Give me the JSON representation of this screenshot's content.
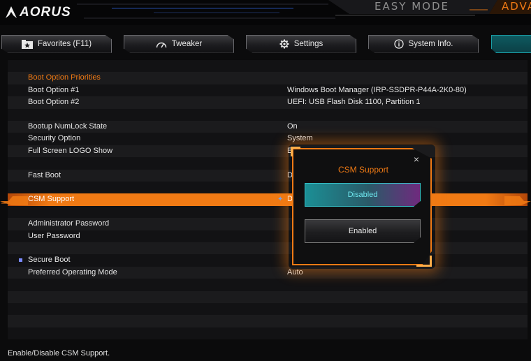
{
  "header": {
    "logo_text": "AORUS",
    "easy_mode_label": "EASY MODE",
    "advanced_mode_label": "ADVA"
  },
  "tabs": [
    {
      "label": "Favorites (F11)",
      "icon": "star-folder-icon"
    },
    {
      "label": "Tweaker",
      "icon": "speedometer-icon"
    },
    {
      "label": "Settings",
      "icon": "gear-icon"
    },
    {
      "label": "System Info.",
      "icon": "info-icon"
    }
  ],
  "settings": {
    "boot_section": "Boot Option Priorities",
    "boot1": {
      "label": "Boot Option #1",
      "value": "Windows Boot Manager (IRP-SSDPR-P44A-2K0-80)"
    },
    "boot2": {
      "label": "Boot Option #2",
      "value": "UEFI: USB Flash Disk 1100, Partition 1"
    },
    "numlock": {
      "label": "Bootup NumLock State",
      "value": "On"
    },
    "security": {
      "label": "Security Option",
      "value": "System"
    },
    "logo": {
      "label": "Full Screen LOGO Show",
      "value": "En"
    },
    "fastboot": {
      "label": "Fast Boot",
      "value": "D"
    },
    "csm": {
      "label": "CSM Support",
      "value": "D"
    },
    "admin_pwd": {
      "label": "Administrator Password"
    },
    "user_pwd": {
      "label": "User Password"
    },
    "secure_boot": {
      "label": "Secure Boot"
    },
    "pref_mode": {
      "label": "Preferred Operating Mode",
      "value": "Auto"
    }
  },
  "popup": {
    "title": "CSM Support",
    "close": "×",
    "options": [
      {
        "label": "Disabled",
        "selected": true
      },
      {
        "label": "Enabled",
        "selected": false
      }
    ]
  },
  "footer": {
    "help_text": "Enable/Disable CSM Support."
  },
  "colors": {
    "accent_orange": "#f07a14",
    "accent_teal": "#36c1c9",
    "background": "#0b0b0c"
  }
}
